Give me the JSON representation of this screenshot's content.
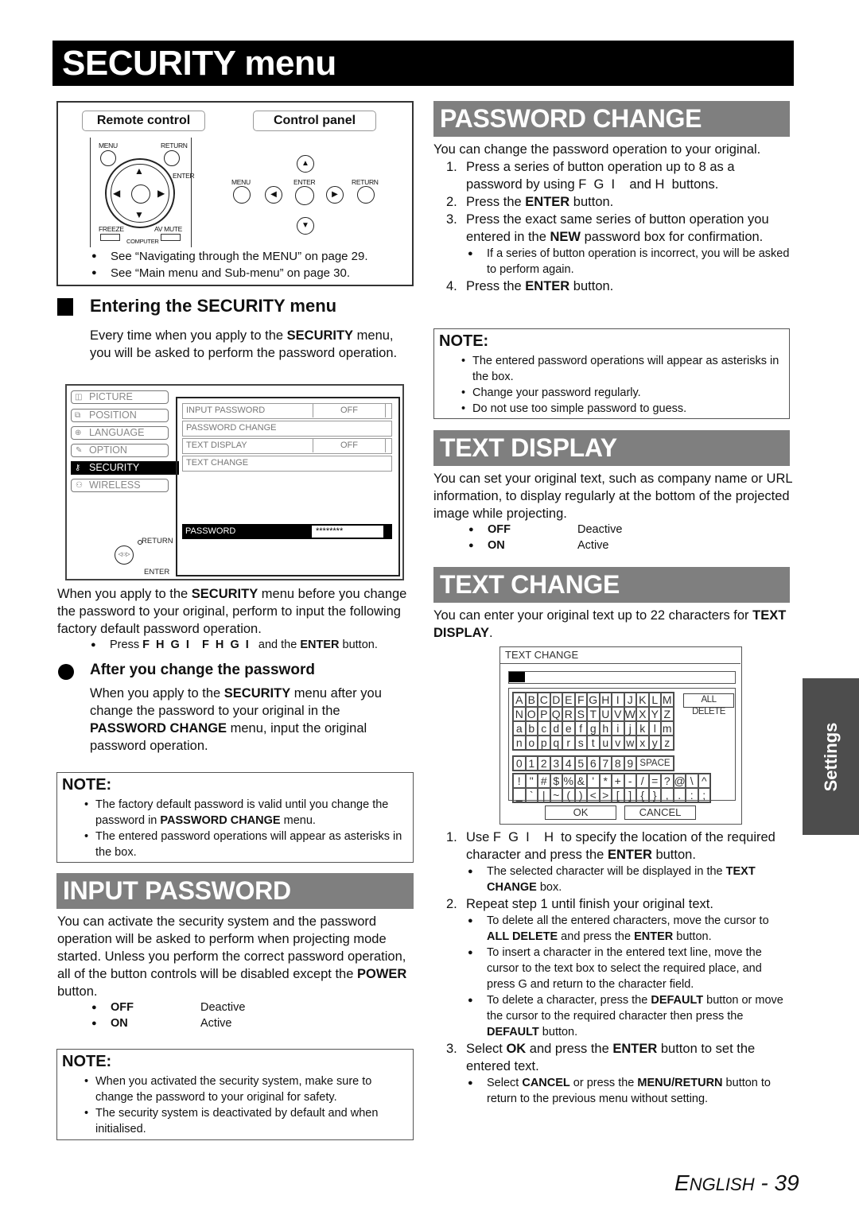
{
  "page": {
    "title": "SECURITY menu",
    "footer_lang": "ENGLISH",
    "footer_page": "- 39",
    "side_tab": "Settings"
  },
  "control_figure": {
    "remote_label": "Remote control",
    "panel_label": "Control panel",
    "remote_buttons": {
      "menu": "MENU",
      "return": "RETURN",
      "enter": "ENTER",
      "freeze": "FREEZE",
      "av_mute": "AV MUTE",
      "computer": "COMPUTER"
    },
    "panel_buttons": {
      "menu": "MENU",
      "enter": "ENTER",
      "return": "RETURN"
    },
    "notes": [
      "See “Navigating through the MENU” on page 29.",
      "See “Main menu and Sub-menu” on page 30."
    ]
  },
  "entering": {
    "heading": "Entering the SECURITY menu",
    "p1_a": "Every time when you apply to the ",
    "p1_b": "SECURITY",
    "p1_c": " menu, you will be asked to perform the password operation.",
    "osd": {
      "side_items": [
        "PICTURE",
        "POSITION",
        "LANGUAGE",
        "OPTION",
        "SECURITY",
        "WIRELESS"
      ],
      "selected_index": 4,
      "rows": [
        {
          "label": "INPUT PASSWORD",
          "value": "OFF"
        },
        {
          "label": "PASSWORD CHANGE",
          "value": ""
        },
        {
          "label": "TEXT DISPLAY",
          "value": "OFF"
        },
        {
          "label": "TEXT CHANGE",
          "value": ""
        }
      ],
      "password_label": "PASSWORD",
      "password_value": "********",
      "nav_return": "RETURN",
      "nav_enter": "ENTER"
    },
    "p2_a": "When you apply to the ",
    "p2_b": "SECURITY",
    "p2_c": " menu before you change the password to your original, perform to input the following factory default password operation.",
    "press_a": "Press ",
    "press_keys": "F  H  G  I    F  H  G  I",
    "press_b": "   and the ",
    "press_c": "ENTER",
    "press_d": " button."
  },
  "after_change": {
    "heading": "After you change the password",
    "p_a": "When you apply to the ",
    "p_b": "SECURITY",
    "p_c": " menu after you change the password to your original in the ",
    "p_d": "PASSWORD CHANGE",
    "p_e": " menu, input the original password operation."
  },
  "note1": {
    "title": "NOTE:",
    "item1_a": "The factory default password is valid until you change the password in ",
    "item1_b": "PASSWORD CHANGE",
    "item1_c": " menu.",
    "item2": "The entered password operations will appear as asterisks in the box."
  },
  "input_password": {
    "heading": "INPUT PASSWORD",
    "p_a": "You can activate the security system and the password operation will be asked to perform when projecting mode started. Unless you perform the correct password operation, all of the button controls will be disabled except the ",
    "p_b": "POWER",
    "p_c": " button.",
    "options": [
      {
        "key": "OFF",
        "desc": "Deactive"
      },
      {
        "key": "ON",
        "desc": "Active"
      }
    ]
  },
  "note2": {
    "title": "NOTE:",
    "items": [
      "When you activated the security system, make sure to change the password to your original for safety.",
      "The security system is deactivated by default and when initialised."
    ]
  },
  "password_change": {
    "heading": "PASSWORD CHANGE",
    "intro": "You can change the password operation to your original.",
    "s1": "Press a series of button operation up to 8 as a password by using F  G  I    and H  buttons.",
    "s2_a": "Press the ",
    "s2_b": "ENTER",
    "s2_c": " button.",
    "s3_a": "Press the exact same series of button operation you entered in the ",
    "s3_b": "NEW",
    "s3_c": " password box for confirmation.",
    "s3_sub": "If a series of button operation is incorrect, you will be asked to perform again.",
    "s4_a": "Press the ",
    "s4_b": "ENTER",
    "s4_c": " button."
  },
  "note3": {
    "title": "NOTE:",
    "items": [
      "The entered password operations will appear as asterisks in the box.",
      "Change your password regularly.",
      "Do not use too simple password to guess."
    ]
  },
  "text_display": {
    "heading": "TEXT DISPLAY",
    "intro": "You can set your original text, such as company name or URL information, to display regularly at the bottom of the projected image while projecting.",
    "options": [
      {
        "key": "OFF",
        "desc": "Deactive"
      },
      {
        "key": "ON",
        "desc": "Active"
      }
    ]
  },
  "text_change": {
    "heading": "TEXT CHANGE",
    "intro_a": "You can enter your original text up to 22 characters for ",
    "intro_b": "TEXT DISPLAY",
    "intro_c": ".",
    "dialog": {
      "title": "TEXT CHANGE",
      "all_delete": "ALL DELETE",
      "space": "SPACE",
      "ok": "OK",
      "cancel": "CANCEL",
      "letters": [
        "A",
        "B",
        "C",
        "D",
        "E",
        "F",
        "G",
        "H",
        "I",
        "J",
        "K",
        "L",
        "M",
        "N",
        "O",
        "P",
        "Q",
        "R",
        "S",
        "T",
        "U",
        "V",
        "W",
        "X",
        "Y",
        "Z",
        "a",
        "b",
        "c",
        "d",
        "e",
        "f",
        "g",
        "h",
        "i",
        "j",
        "k",
        "l",
        "m",
        "n",
        "o",
        "p",
        "q",
        "r",
        "s",
        "t",
        "u",
        "v",
        "w",
        "x",
        "y",
        "z"
      ],
      "digits": [
        "0",
        "1",
        "2",
        "3",
        "4",
        "5",
        "6",
        "7",
        "8",
        "9"
      ],
      "symbols": [
        "!",
        "\"",
        "#",
        "$",
        "%",
        "&",
        "'",
        "*",
        "+",
        "-",
        "/",
        "=",
        "?",
        "@",
        "\\",
        "^",
        "_",
        "`",
        "|",
        "~",
        "(",
        ")",
        "<",
        ">",
        "[",
        "]",
        "{",
        "}",
        ",",
        ".",
        ":",
        ";"
      ]
    },
    "s1_a": "Use F  G  I    H  to specify the location of the required character and press the ",
    "s1_b": "ENTER",
    "s1_c": " button.",
    "s1_sub_a": "The selected character will be displayed in the ",
    "s1_sub_b": "TEXT CHANGE",
    "s1_sub_c": " box.",
    "s2": "Repeat step 1 until finish your original text.",
    "s2_sub1_a": "To delete all the entered characters, move the cursor to ",
    "s2_sub1_b": "ALL DELETE",
    "s2_sub1_c": " and press the ",
    "s2_sub1_d": "ENTER",
    "s2_sub1_e": " button.",
    "s2_sub2": "To insert a character in the entered text line, move the cursor to the text box to select the required place, and press G  and return to the character field.",
    "s2_sub3_a": "To delete a character, press the ",
    "s2_sub3_b": "DEFAULT",
    "s2_sub3_c": " button or move the cursor to the required character then press the ",
    "s2_sub3_d": "DEFAULT",
    "s2_sub3_e": " button.",
    "s3_a": "Select ",
    "s3_b": "OK",
    "s3_c": " and press the ",
    "s3_d": "ENTER",
    "s3_e": " button to set the entered text.",
    "s3_sub_a": "Select ",
    "s3_sub_b": "CANCEL",
    "s3_sub_c": " or press the ",
    "s3_sub_d": "MENU/RETURN",
    "s3_sub_e": " button to return to the previous menu without setting."
  }
}
